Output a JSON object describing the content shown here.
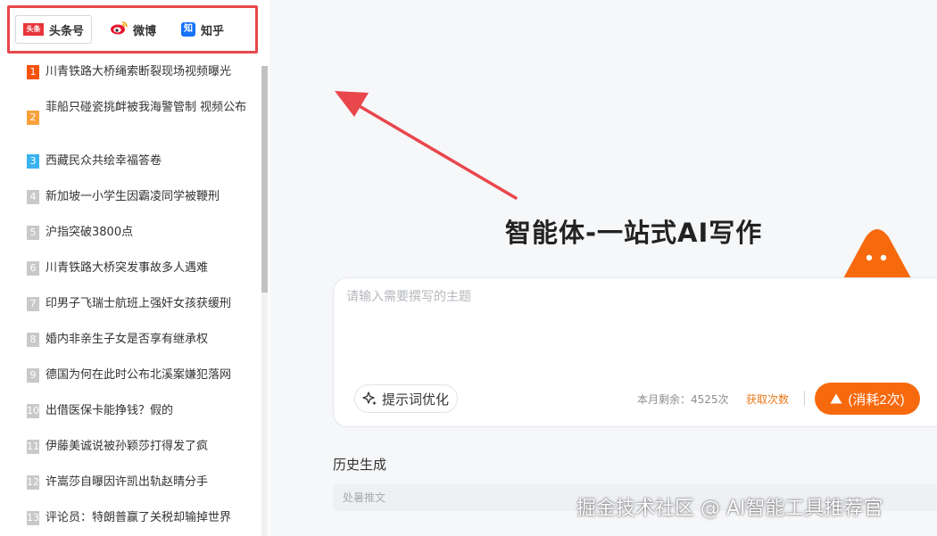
{
  "sidebar": {
    "tabs": [
      {
        "label": "头条号",
        "icon": "toutiao-icon",
        "icon_text": "头条"
      },
      {
        "label": "微博",
        "icon": "weibo-icon"
      },
      {
        "label": "知乎",
        "icon": "zhihu-icon",
        "icon_text": "知"
      }
    ],
    "items": [
      {
        "rank": "1",
        "text": "川青铁路大桥绳索断裂现场视频曝光"
      },
      {
        "rank": "2",
        "text": "菲船只碰瓷挑衅被我海警管制 视频公布"
      },
      {
        "rank": "3",
        "text": "西藏民众共绘幸福答卷"
      },
      {
        "rank": "4",
        "text": "新加坡一小学生因霸凌同学被鞭刑"
      },
      {
        "rank": "5",
        "text": "沪指突破3800点"
      },
      {
        "rank": "6",
        "text": "川青铁路大桥突发事故多人遇难"
      },
      {
        "rank": "7",
        "text": "印男子飞瑞士航班上强奸女孩获缓刑"
      },
      {
        "rank": "8",
        "text": "婚内非亲生子女是否享有继承权"
      },
      {
        "rank": "9",
        "text": "德国为何在此时公布北溪案嫌犯落网"
      },
      {
        "rank": "10",
        "text": "出借医保卡能挣钱？假的"
      },
      {
        "rank": "11",
        "text": "伊藤美诚说被孙颖莎打得发了疯"
      },
      {
        "rank": "12",
        "text": "许嵩莎自曝因许凯出轨赵晴分手"
      },
      {
        "rank": "13",
        "text": "评论员：特朗普赢了关税却输掉世界"
      }
    ]
  },
  "main": {
    "title": "智能体-一站式AI写作",
    "input_placeholder": "请输入需要撰写的主题",
    "optimize_label": "提示词优化",
    "remaining": "本月剩余：4525次",
    "get_count": "获取次数",
    "generate_label": "(消耗2次)",
    "history_title": "历史生成",
    "history_items": [
      "处暑推文"
    ]
  },
  "watermark": "掘金技术社区 @ AI智能工具推荐官",
  "colors": {
    "accent": "#f7690d",
    "highlight_border": "#e8474c",
    "rank1": "#f5520c",
    "rank2": "#f7a13a",
    "rank3": "#38b3f0"
  }
}
